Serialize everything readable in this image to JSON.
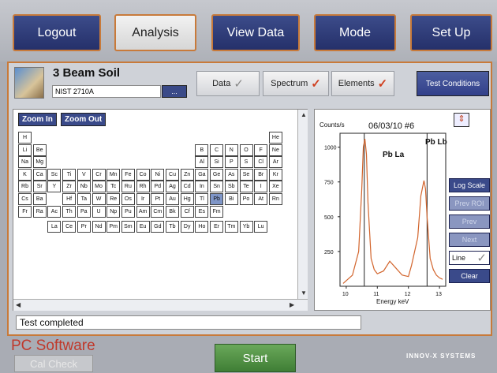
{
  "top_nav": {
    "logout": "Logout",
    "analysis": "Analysis",
    "view_data": "View Data",
    "mode": "Mode",
    "setup": "Set Up"
  },
  "header": {
    "title": "3 Beam Soil",
    "sample": "NIST 2710A",
    "browse": "...",
    "data": "Data",
    "spectrum": "Spectrum",
    "elements": "Elements",
    "test_conditions": "Test Conditions"
  },
  "periodic": {
    "zoom_in": "Zoom In",
    "zoom_out": "Zoom Out",
    "rows": [
      [
        "H",
        "",
        "",
        "",
        "",
        "",
        "",
        "",
        "",
        "",
        "",
        "",
        "",
        "",
        "",
        "",
        "",
        "He"
      ],
      [
        "Li",
        "Be",
        "",
        "",
        "",
        "",
        "",
        "",
        "",
        "",
        "",
        "",
        "B",
        "C",
        "N",
        "O",
        "F",
        "Ne"
      ],
      [
        "Na",
        "Mg",
        "",
        "",
        "",
        "",
        "",
        "",
        "",
        "",
        "",
        "",
        "Al",
        "Si",
        "P",
        "S",
        "Cl",
        "Ar"
      ],
      [
        "K",
        "Ca",
        "Sc",
        "Ti",
        "V",
        "Cr",
        "Mn",
        "Fe",
        "Co",
        "Ni",
        "Cu",
        "Zn",
        "Ga",
        "Ge",
        "As",
        "Se",
        "Br",
        "Kr"
      ],
      [
        "Rb",
        "Sr",
        "Y",
        "Zr",
        "Nb",
        "Mo",
        "Tc",
        "Ru",
        "Rh",
        "Pd",
        "Ag",
        "Cd",
        "In",
        "Sn",
        "Sb",
        "Te",
        "I",
        "Xe"
      ],
      [
        "Cs",
        "Ba",
        "",
        "Hf",
        "Ta",
        "W",
        "Re",
        "Os",
        "Ir",
        "Pt",
        "Au",
        "Hg",
        "Tl",
        "Pb",
        "Bi",
        "Po",
        "At",
        "Rn"
      ],
      [
        "Fr",
        "Ra",
        "Ac",
        "Th",
        "Pa",
        "U",
        "Np",
        "Pu",
        "Am",
        "Cm",
        "Bk",
        "Cf",
        "Es",
        "Fm",
        "",
        "",
        "",
        ""
      ],
      [
        "",
        "",
        "La",
        "Ce",
        "Pr",
        "Nd",
        "Pm",
        "Sm",
        "Eu",
        "Gd",
        "Tb",
        "Dy",
        "Ho",
        "Er",
        "Tm",
        "Yb",
        "Lu",
        ""
      ]
    ],
    "selected": "Pb"
  },
  "spectrum": {
    "ylabel": "Counts/s",
    "date": "06/03/10 #6",
    "peak1": "Pb La",
    "peak2": "Pb Lb",
    "xlabel": "Energy keV",
    "yticks": [
      "1000",
      "750",
      "500",
      "250"
    ],
    "xticks": [
      "10",
      "11",
      "12",
      "13"
    ]
  },
  "side_controls": {
    "log_scale": "Log Scale",
    "prev_roi": "Prev ROI",
    "prev": "Prev",
    "next": "Next",
    "line": "Line",
    "clear": "Clear"
  },
  "status": "Test completed",
  "footer": {
    "pc_software": "PC Software",
    "cal_check": "Cal Check",
    "start": "Start",
    "brand": "INNOV-X SYSTEMS"
  },
  "chart_data": {
    "type": "line",
    "title": "",
    "xlabel": "Energy keV",
    "ylabel": "Counts/s",
    "xlim": [
      9.8,
      13.2
    ],
    "ylim": [
      0,
      1100
    ],
    "series": [
      {
        "name": "",
        "x": [
          9.9,
          10.2,
          10.4,
          10.5,
          10.55,
          10.6,
          10.65,
          10.7,
          10.8,
          10.9,
          11.0,
          11.2,
          11.4,
          11.6,
          11.8,
          12.0,
          12.1,
          12.3,
          12.4,
          12.5,
          12.55,
          12.6,
          12.7,
          12.8,
          12.9,
          13.0,
          13.1
        ],
        "y": [
          20,
          80,
          250,
          700,
          1000,
          1060,
          950,
          600,
          200,
          120,
          90,
          110,
          180,
          130,
          80,
          70,
          150,
          350,
          650,
          760,
          700,
          500,
          200,
          120,
          80,
          60,
          50
        ]
      }
    ]
  }
}
